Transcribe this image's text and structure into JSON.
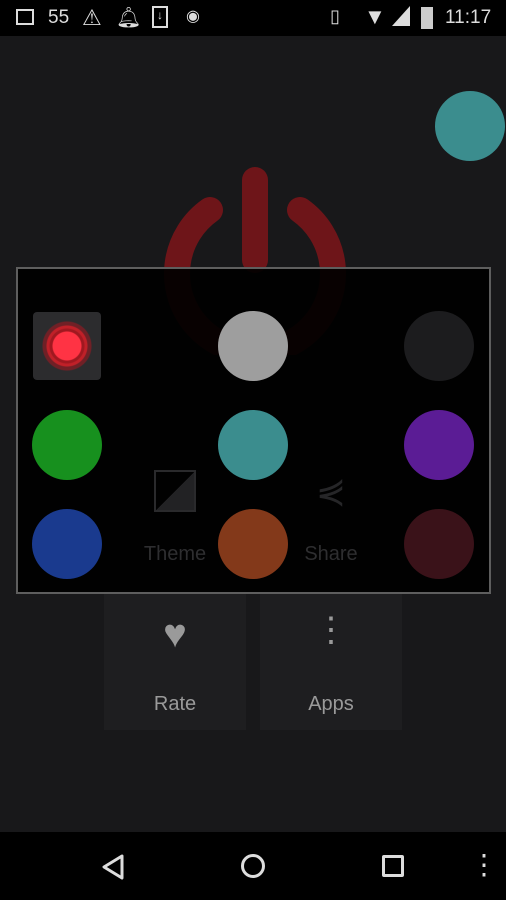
{
  "status_bar": {
    "notification_count": "55",
    "time": "11:17"
  },
  "background": {
    "tiles": [
      {
        "label": "Theme"
      },
      {
        "label": "Share"
      },
      {
        "label": "Rate"
      },
      {
        "label": "Apps"
      }
    ],
    "power_color": "#6e1519",
    "fab_color": "#3b8d8e"
  },
  "color_picker": {
    "selected": "red",
    "swatches": [
      {
        "name": "red",
        "color": "#ff3344"
      },
      {
        "name": "gray",
        "color": "#9e9e9e"
      },
      {
        "name": "black",
        "color": "#1c1c1e"
      },
      {
        "name": "green",
        "color": "#17901e"
      },
      {
        "name": "teal",
        "color": "#3b8d8e"
      },
      {
        "name": "purple",
        "color": "#5b1c95"
      },
      {
        "name": "blue",
        "color": "#1a3a8e"
      },
      {
        "name": "orange",
        "color": "#83391a"
      },
      {
        "name": "maroon",
        "color": "#3a1219"
      }
    ]
  }
}
